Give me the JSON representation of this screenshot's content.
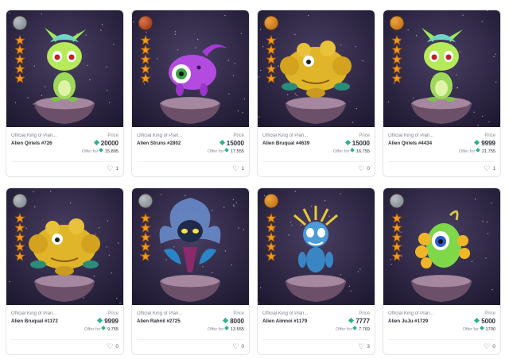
{
  "price_label": "Price",
  "offer_label": "Offer for",
  "colors": {
    "card_border": "#e3e5ea",
    "gem": "#27b38b",
    "space_bg": "#2a2440",
    "star": "#f39a1c"
  },
  "cards": [
    {
      "collection": "Official King of Plan...",
      "name": "Alien Qiriels #726",
      "price": "20000",
      "offer": "15.895",
      "likes": "1",
      "planet": "grey",
      "creature": "qiriels"
    },
    {
      "collection": "Official King of Plan...",
      "name": "Alien Struns #2802",
      "price": "15000",
      "offer": "17.555",
      "likes": "1",
      "planet": "red",
      "creature": "struns"
    },
    {
      "collection": "Official King of Plan...",
      "name": "Alien Bruqual #4639",
      "price": "15000",
      "offer": "16.755",
      "likes": "0",
      "planet": "orange",
      "creature": "bruqual"
    },
    {
      "collection": "Official King of Plan...",
      "name": "Alien Qiriels #4434",
      "price": "9999",
      "offer": "21.755",
      "likes": "1",
      "planet": "orange",
      "creature": "qiriels"
    },
    {
      "collection": "Official King of Plan...",
      "name": "Alien Bruqual #1172",
      "price": "9999",
      "offer": "9.755",
      "likes": "0",
      "planet": "grey",
      "creature": "bruqual"
    },
    {
      "collection": "Official King of Plan...",
      "name": "Alien Rahnil #2725",
      "price": "8000",
      "offer": "13.555",
      "likes": "0",
      "planet": "grey",
      "creature": "rahnil"
    },
    {
      "collection": "Official King of Plan...",
      "name": "Alien Aimnoi #1179",
      "price": "7777",
      "offer": "7.769",
      "likes": "3",
      "planet": "orange",
      "creature": "aimnoi"
    },
    {
      "collection": "Official King of Plan...",
      "name": "Alien JuJu #1729",
      "price": "5000",
      "offer": "1700",
      "likes": "0",
      "planet": "grey",
      "creature": "juju"
    }
  ]
}
